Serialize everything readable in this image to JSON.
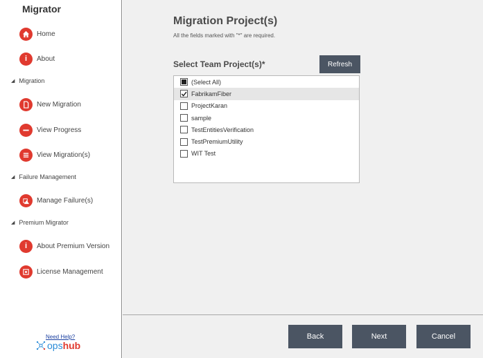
{
  "app": {
    "title": "Migrator"
  },
  "sidebar": {
    "items": [
      {
        "label": "Home"
      },
      {
        "label": "About"
      },
      {
        "label": "New Migration"
      },
      {
        "label": "View Progress"
      },
      {
        "label": "View Migration(s)"
      },
      {
        "label": "Manage Failure(s)"
      },
      {
        "label": "About Premium Version"
      },
      {
        "label": "License Management"
      }
    ],
    "sections": [
      {
        "label": "Migration"
      },
      {
        "label": "Failure Management"
      },
      {
        "label": "Premium Migrator"
      }
    ],
    "help_link": "Need Help?",
    "brand_part1": "ops",
    "brand_part2": "hub"
  },
  "main": {
    "title": "Migration Project(s)",
    "subtitle": "All the fields marked with \"*\" are required.",
    "section_label": "Select Team Project(s)*",
    "refresh_label": "Refresh",
    "projects": [
      {
        "label": "(Select All)",
        "state": "partial"
      },
      {
        "label": "FabrikamFiber",
        "state": "checked"
      },
      {
        "label": "ProjectKaran",
        "state": "unchecked"
      },
      {
        "label": "sample",
        "state": "unchecked"
      },
      {
        "label": "TestEntitiesVerification",
        "state": "unchecked"
      },
      {
        "label": "TestPremiumUtility",
        "state": "unchecked"
      },
      {
        "label": "WIT Test",
        "state": "unchecked"
      }
    ]
  },
  "footer": {
    "back_label": "Back",
    "next_label": "Next",
    "cancel_label": "Cancel"
  },
  "colors": {
    "accent_red": "#e03a2f",
    "button_gray": "#4b5563",
    "brand_blue": "#2a8bd8"
  }
}
